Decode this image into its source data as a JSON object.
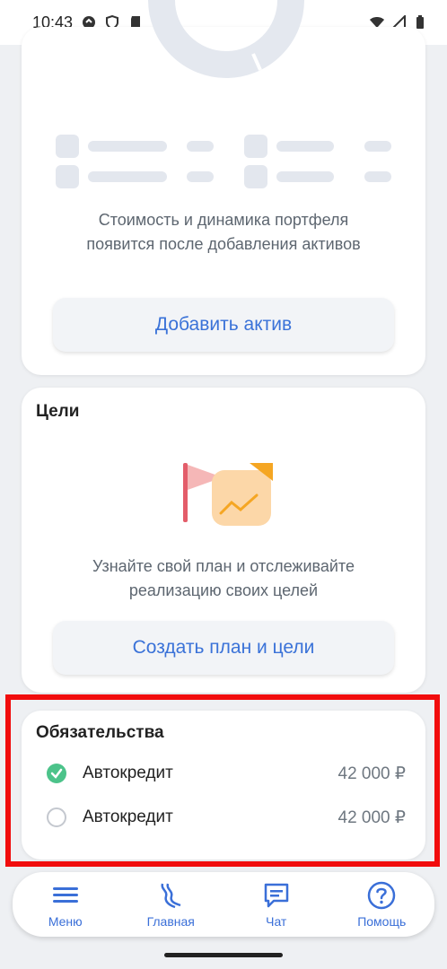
{
  "status_bar": {
    "time": "10:43"
  },
  "portfolio": {
    "empty_text": "Стоимость и динамика портфеля появится после добавления активов",
    "add_button": "Добавить актив"
  },
  "goals": {
    "title": "Цели",
    "description": "Узнайте свой план и отслеживайте реализацию своих целей",
    "button": "Создать план и цели"
  },
  "liabilities": {
    "title": "Обязательства",
    "items": [
      {
        "name": "Автокредит",
        "amount": "42 000 ₽",
        "checked": true
      },
      {
        "name": "Автокредит",
        "amount": "42 000 ₽",
        "checked": false
      }
    ]
  },
  "nav": {
    "items": [
      {
        "label": "Меню",
        "icon": "menu-icon"
      },
      {
        "label": "Главная",
        "icon": "home-logo-icon"
      },
      {
        "label": "Чат",
        "icon": "chat-icon"
      },
      {
        "label": "Помощь",
        "icon": "help-icon"
      }
    ]
  },
  "colors": {
    "accent": "#3a72d8",
    "highlight": "#f10d0d",
    "check": "#4cc38a"
  }
}
